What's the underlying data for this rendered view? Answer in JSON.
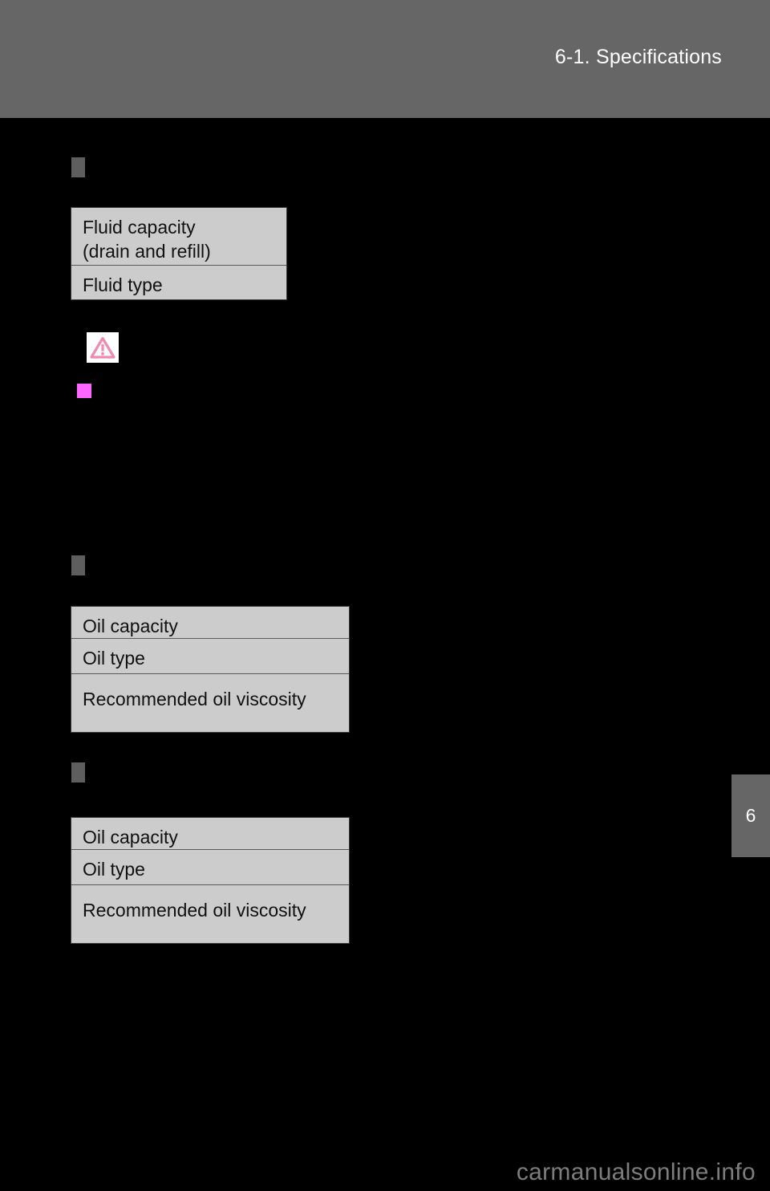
{
  "header": {
    "title": "6-1. Specifications"
  },
  "page_tab": {
    "number": "6"
  },
  "sections": [
    {
      "marker": "section-marker",
      "table": {
        "rows": [
          {
            "label": "Fluid capacity\n (drain and refill)"
          },
          {
            "label": "Fluid type"
          }
        ]
      }
    },
    {
      "marker": "section-marker",
      "table": {
        "rows": [
          {
            "label": "Oil capacity"
          },
          {
            "label": "Oil type"
          },
          {
            "label": "Recommended oil viscosity"
          }
        ]
      }
    },
    {
      "marker": "section-marker",
      "table": {
        "rows": [
          {
            "label": "Oil capacity"
          },
          {
            "label": "Oil type"
          },
          {
            "label": "Recommended oil viscosity"
          }
        ]
      }
    }
  ],
  "icons": {
    "warning": "warning-triangle-icon",
    "notice": "notice-square-icon"
  },
  "watermark": {
    "text": "carmanualsonline.info"
  },
  "colors": {
    "header_band": "#666666",
    "page_background": "#000000",
    "table_background": "#cccccc",
    "warning_pink": "#f08ab0",
    "notice_magenta": "#ff66ff",
    "tab_gray": "#666666",
    "watermark_gray": "#7d7d7d"
  }
}
